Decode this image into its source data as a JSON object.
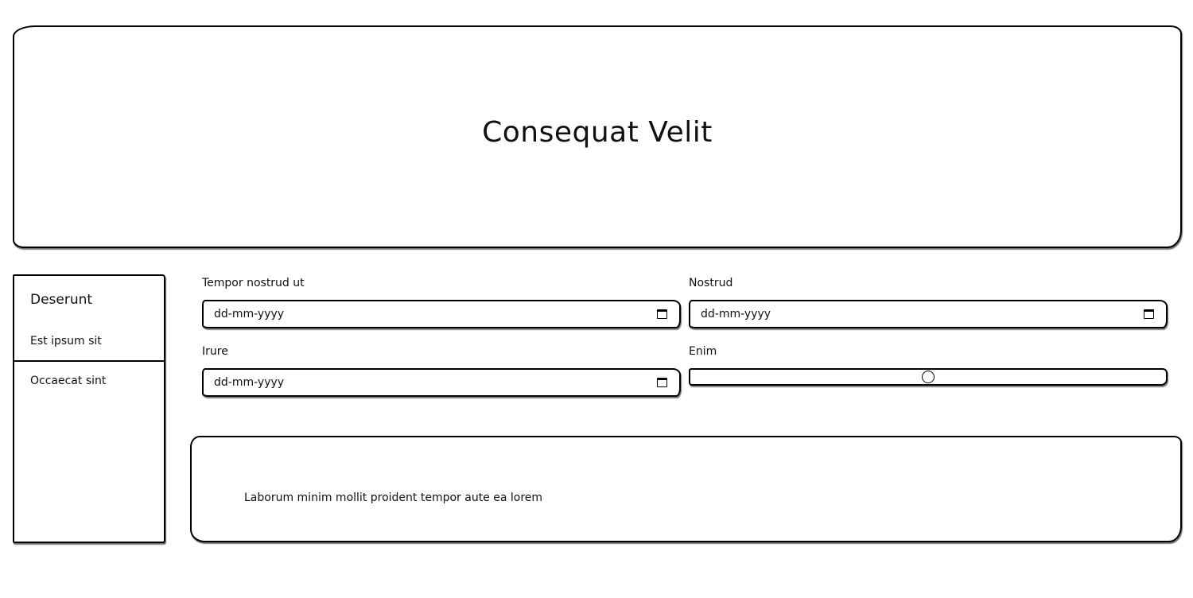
{
  "header": {
    "title": "Consequat Velit"
  },
  "sidebar": {
    "title": "Deserunt",
    "items": [
      {
        "label": "Est ipsum sit"
      },
      {
        "label": "Occaecat sint"
      }
    ]
  },
  "form": {
    "fields": [
      {
        "label": "Tempor nostrud ut",
        "placeholder": "dd-mm-yyyy",
        "icon": "calendar-icon"
      },
      {
        "label": "Nostrud",
        "placeholder": "dd-mm-yyyy",
        "icon": "calendar-icon"
      },
      {
        "label": "Irure",
        "placeholder": "dd-mm-yyyy",
        "icon": "calendar-icon"
      }
    ],
    "slider": {
      "label": "Enim",
      "value_fraction": 0.5
    }
  },
  "note": {
    "text": "Laborum minim mollit proident tempor aute ea lorem"
  }
}
